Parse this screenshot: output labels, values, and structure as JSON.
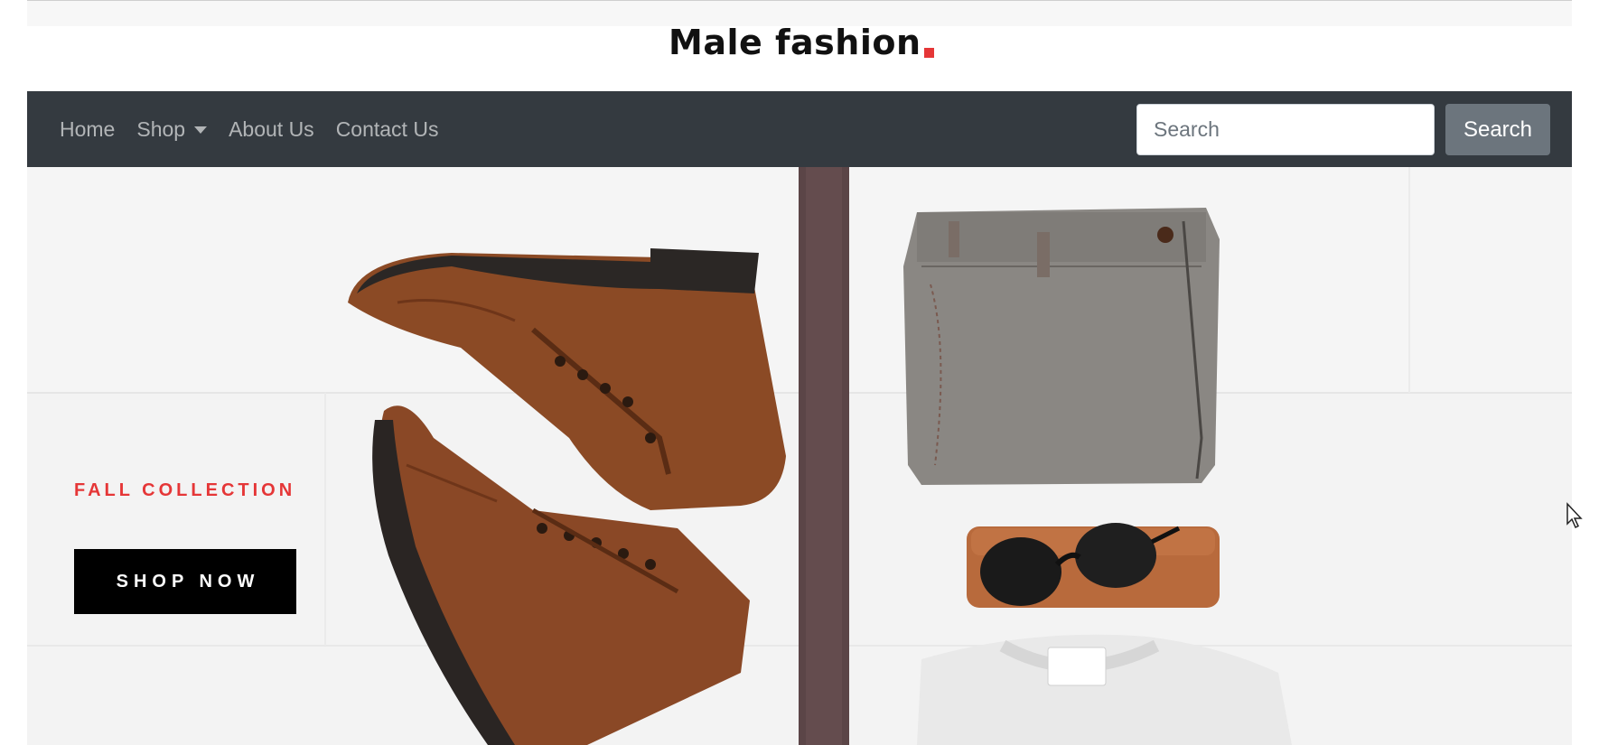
{
  "header": {
    "logo_text": "Male fashion",
    "accent_color": "#e53637"
  },
  "nav": {
    "items": [
      {
        "label": "Home"
      },
      {
        "label": "Shop",
        "has_dropdown": true
      },
      {
        "label": "About Us"
      },
      {
        "label": "Contact Us"
      }
    ],
    "background": "#343a40"
  },
  "search": {
    "placeholder": "Search",
    "value": "",
    "button_label": "Search"
  },
  "hero": {
    "eyebrow": "FALL COLLECTION",
    "cta_label": "SHOP NOW",
    "image_subject": "flat-lay of brown leather boots, belt, grey trousers, sunglasses and white sweater"
  },
  "icons": {
    "caret": "chevron-down-icon",
    "cursor": "mouse-pointer-icon"
  }
}
